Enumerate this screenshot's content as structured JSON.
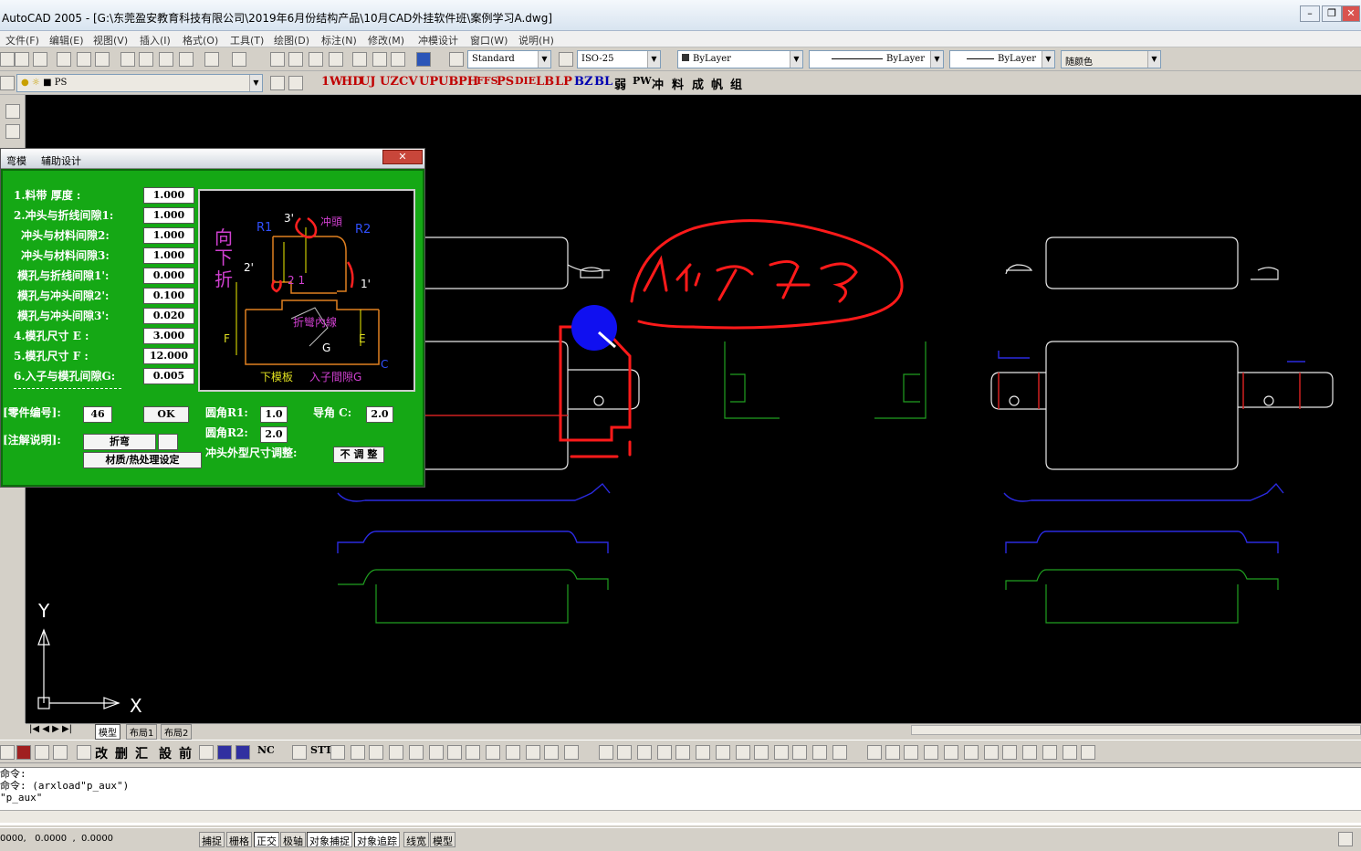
{
  "window": {
    "title": "AutoCAD 2005 - [G:\\东莞盈安教育科技有限公司\\2019年6月份结构产品\\10月CAD外挂软件班\\案例学习A.dwg]"
  },
  "menu": [
    "文件(F)",
    "编辑(E)",
    "视图(V)",
    "插入(I)",
    "格式(O)",
    "工具(T)",
    "绘图(D)",
    "标注(N)",
    "修改(M)",
    "冲模设计",
    "窗口(W)",
    "说明(H)"
  ],
  "toolbar": {
    "text_style": "Standard",
    "dim_style": "ISO-25",
    "layer_color": "ByLayer",
    "linetype": "ByLayer",
    "lineweight": "ByLayer",
    "plot_style": "随颜色",
    "layer_name": "PS"
  },
  "custom_tools": [
    "1W",
    "HD",
    "UJ",
    "UZ",
    "CV",
    "UP",
    "UB",
    "PH",
    "FFS",
    "PS",
    "DIE",
    "LB",
    "LP",
    "BZ",
    "BL",
    "弱",
    "PW",
    "冲",
    "料",
    "成",
    "帆",
    "组"
  ],
  "bottom_tools": [
    "改",
    "删",
    "汇",
    "設",
    "前",
    "NC",
    "STT"
  ],
  "dialog": {
    "title_tab1": "弯模",
    "title_tab2": "辅助设计",
    "close": "✕",
    "fields": [
      {
        "label": "1.料带  厚度     :",
        "value": "1.000"
      },
      {
        "label": "2.冲头与折线间隙1:",
        "value": "1.000"
      },
      {
        "label": "冲头与材料间隙2:",
        "value": "1.000"
      },
      {
        "label": "冲头与材料间隙3:",
        "value": "1.000"
      },
      {
        "label": "模孔与折线间隙1':",
        "value": "0.000"
      },
      {
        "label": "模孔与冲头间隙2':",
        "value": "0.100"
      },
      {
        "label": "模孔与冲头间隙3':",
        "value": "0.020"
      },
      {
        "label": "4.模孔尺寸  E   :",
        "value": "3.000"
      },
      {
        "label": "5.模孔尺寸  F   :",
        "value": "12.000"
      },
      {
        "label": "6.入子与模孔间隙G:",
        "value": "0.005"
      }
    ],
    "part_no_label": "[零件编号]:",
    "part_no": "46",
    "ok": "OK",
    "r1_label": "圆角R1:",
    "r1": "1.0",
    "guide_c_label": "导角 C:",
    "guide_c": "2.0",
    "r2_label": "圆角R2:",
    "r2": "2.0",
    "note_label": "[注解说明]:",
    "note_value": "折弯",
    "material_btn": "材质/热处理设定",
    "punch_adjust_label": "冲头外型尺寸调整:",
    "punch_adjust_btn": "不 调 整",
    "preview": {
      "down_fold": "向下折",
      "punch": "冲頭",
      "r1": "R1",
      "r2": "R2",
      "a3": "3'",
      "a2": "2'",
      "a21": "2 1",
      "a1": "1'",
      "fold_line": "折彎內線",
      "e": "E",
      "f": "F",
      "g": "G",
      "c": "C",
      "lower_plate": "下模板",
      "insert_gap": "入子間隙G"
    }
  },
  "ucs": {
    "y": "Y",
    "x": "X"
  },
  "tabs": [
    "模型",
    "布局1",
    "布局2"
  ],
  "command_lines": [
    "命令:",
    "命令: (arxload\"p_aux\")",
    "\"p_aux\""
  ],
  "status": {
    "coords": "0000,   0.0000  ,  0.0000",
    "buttons": [
      "捕捉",
      "栅格",
      "正交",
      "极轴",
      "对象捕捉",
      "对象追踪",
      "线宽",
      "模型"
    ]
  }
}
